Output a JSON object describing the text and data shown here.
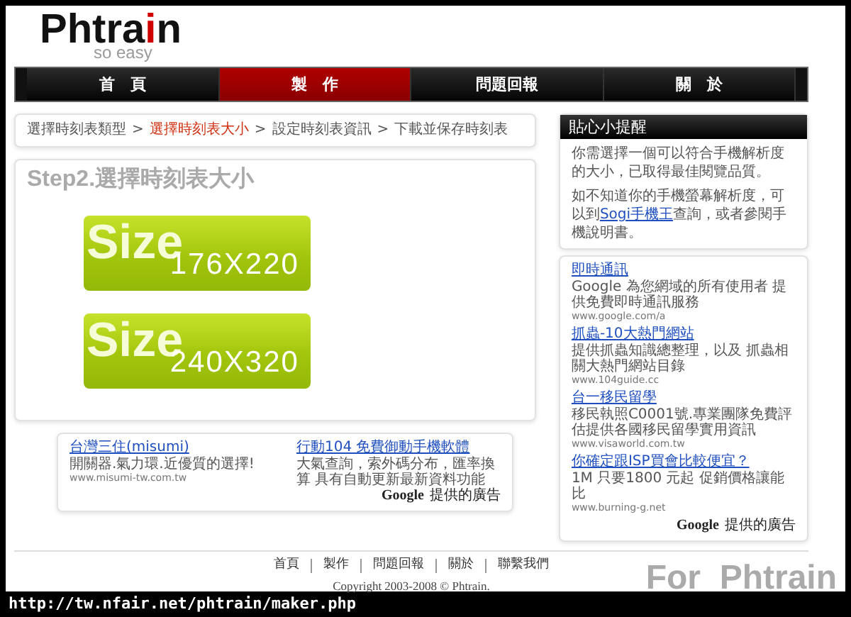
{
  "logo": {
    "parts": [
      {
        "text": "Phtra",
        "accent": false
      },
      {
        "text": "i",
        "accent": true
      },
      {
        "text": "n",
        "accent": false
      }
    ],
    "tagline": "so easy"
  },
  "nav": [
    {
      "label": "首　頁",
      "selected": false
    },
    {
      "label": "製　作",
      "selected": true
    },
    {
      "label": "問題回報",
      "selected": false
    },
    {
      "label": "關　於",
      "selected": false
    }
  ],
  "breadcrumb": [
    {
      "label": "選擇時刻表類型",
      "current": false
    },
    {
      "label": "選擇時刻表大小",
      "current": true
    },
    {
      "label": "設定時刻表資訊",
      "current": false
    },
    {
      "label": "下載並保存時刻表",
      "current": false
    }
  ],
  "breadcrumb_separator": ">",
  "step": {
    "title": "Step2.選擇時刻表大小",
    "options": [
      {
        "watermark": "Size",
        "label": "176X220"
      },
      {
        "watermark": "Size",
        "label": "240X320"
      }
    ]
  },
  "bottom_ads": {
    "items": [
      {
        "title": "台灣三住(misumi)",
        "text": "開關器.氣力環.近優質的選擇!",
        "url": "www.misumi-tw.com.tw"
      },
      {
        "title": "行動104 免費御動手機軟體",
        "text": "大氣查詢，索外碼分布，匯率換算 具有自動更新最新資料功能"
      }
    ],
    "brand": "Google",
    "brand_note": "提供的廣告"
  },
  "tips": {
    "title": "貼心小提醒",
    "paragraph_1": "你需選擇一個可以符合手機解析度的大小，已取得最佳閱覽品質。",
    "paragraph_2_before": "如不知道你的手機螢幕解析度，可以到",
    "paragraph_2_link": "Sogi手機王",
    "paragraph_2_after": "查詢，或者參閱手機說明書。"
  },
  "side_ads": {
    "items": [
      {
        "title": "即時通訊",
        "text": "Google 為您網域的所有使用者 提供免費即時通訊服務",
        "url": "www.google.com/a"
      },
      {
        "title": "抓蟲-10大熱門網站",
        "text": "提供抓蟲知識總整理，以及 抓蟲相關大熱門網站目錄",
        "url": "www.104guide.cc"
      },
      {
        "title": "台一移民留學",
        "text": "移民執照C0001號.專業團隊免費評估提供各國移民留學實用資訊",
        "url": "www.visaworld.com.tw"
      },
      {
        "title": "你確定跟ISP買會比較便宜？",
        "text": "1M 只要1800 元起 促銷價格讓能比",
        "url": "www.burning-g.net"
      }
    ],
    "brand": "Google",
    "brand_note": "提供的廣告"
  },
  "footer": {
    "links": [
      "首頁",
      "製作",
      "問題回報",
      "關於",
      "聯繫我們"
    ],
    "copyright": "Copyright 2003-2008 © Phtrain."
  },
  "caption": {
    "url": "http://tw.nfair.net/phtrain/maker.php",
    "tag": "For  Phtrain"
  }
}
